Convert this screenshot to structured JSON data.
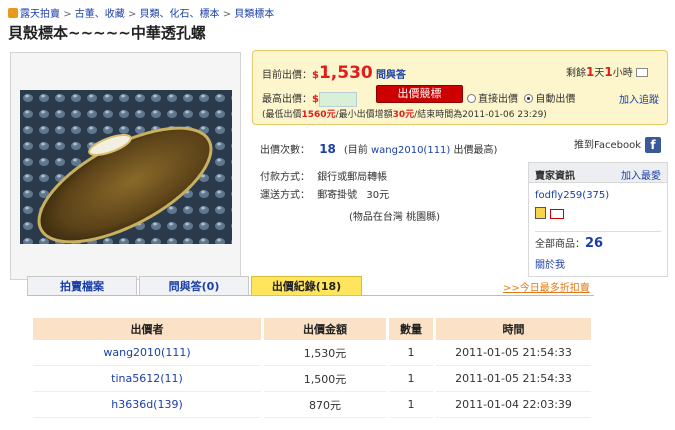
{
  "breadcrumb": {
    "items": [
      "露天拍賣",
      "古董、收藏",
      "貝類、化石、標本",
      "貝類標本"
    ],
    "sep": ">"
  },
  "page_title": "貝殼標本~~~~~中華透孔螺",
  "bid": {
    "current_label": "目前出價：",
    "currency": "$",
    "current_price": "1,530",
    "qa_link": "問與答",
    "time_left": [
      "剩餘",
      "1",
      "天",
      "1",
      "小時"
    ],
    "max_label": "最高出價：",
    "bid_button": "出價競標",
    "direct_bid": "直接出價",
    "auto_bid": "自動出價",
    "watch": "加入追蹤",
    "note": [
      "(最低出價",
      "1560元",
      "/最小出價增額",
      "30元",
      "/結束時間為2011-01-06 23:29)"
    ]
  },
  "bid_count": {
    "label": "出價次數：",
    "count": "18",
    "current": "(目前",
    "leader": "wang2010(111)",
    "tail": "出價最高)"
  },
  "facebook": "推到Facebook",
  "payment": {
    "label": "付款方式：",
    "value": "銀行或郵局轉帳"
  },
  "shipping": {
    "label": "運送方式：",
    "method": "郵寄掛號",
    "fee": "30元",
    "location": "(物品在台灣 桃園縣)"
  },
  "seller": {
    "header": "賣家資訊",
    "add_fav": "加入最愛",
    "name": "fodfly259(375)",
    "all_label": "全部商品：",
    "all_count": "26",
    "about": "關於我"
  },
  "tabs": [
    "拍賣檔案",
    "問與答(0)",
    "出價紀錄(18)"
  ],
  "today_link": ">>今日最多折扣賣",
  "table": {
    "headers": [
      "出價者",
      "出價金額",
      "數量",
      "時間"
    ],
    "rows": [
      [
        "wang2010(111)",
        "1,530元",
        "1",
        "2011-01-05 21:54:33"
      ],
      [
        "tina5612(11)",
        "1,500元",
        "1",
        "2011-01-05 21:54:33"
      ],
      [
        "h3636d(139)",
        "870元",
        "1",
        "2011-01-04 22:03:39"
      ]
    ]
  },
  "colors": {
    "accent_red": "#e21b1b",
    "link_blue": "#1a3ea8",
    "panel_yellow": "#fdf6cc",
    "header_peach": "#fbe2c6"
  }
}
